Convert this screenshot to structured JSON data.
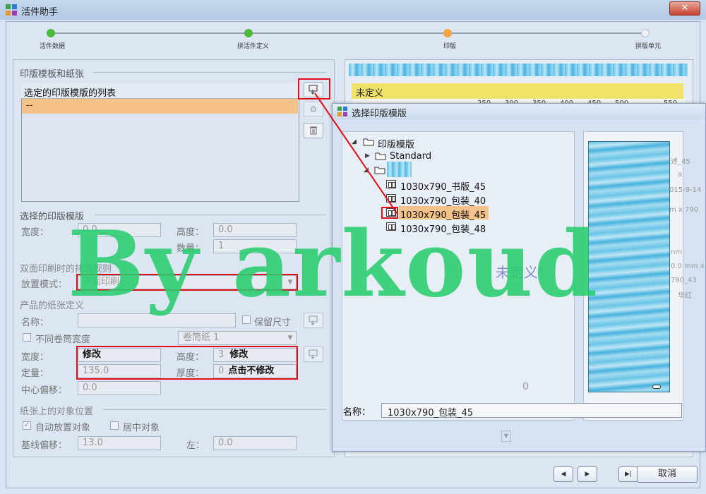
{
  "window": {
    "title": "活件助手",
    "close_label": "✕"
  },
  "steps": [
    {
      "label": "活件数据",
      "state": "done",
      "color": "#4cbb3c"
    },
    {
      "label": "拼活件定义",
      "state": "done",
      "color": "#4cbb3c"
    },
    {
      "label": "印版",
      "state": "current",
      "color": "#f7a340"
    },
    {
      "label": "拼版单元",
      "state": "todo",
      "color": "#e8ecf1"
    }
  ],
  "left": {
    "group_plates": "印版模板和纸张",
    "list_header": "选定的印版模版的列表",
    "list_rows": [
      "--"
    ],
    "group_selected": "选择的印版模版",
    "width_label": "宽度：",
    "width_value": "0.0",
    "height_label": "高度：",
    "height_value": "0.0",
    "qty_label": "数量：",
    "qty_value": "1",
    "duplex_title": "双面印刷时的排版规则",
    "placement_label": "放置模式：",
    "placement_value": "正面印刷",
    "paper_title": "产品的纸张定义",
    "name_label": "名称：",
    "name_value": "",
    "keep_size_label": "保留尺寸",
    "diff_roll_label": "不同卷筒宽度",
    "roll_select": "卷筒纸 1",
    "paper_width_label": "宽度：",
    "paper_width_value": "修改",
    "paper_height_label": "高度：",
    "paper_height_prefix": "3",
    "paper_height_value": "修改",
    "gsm_label": "定量：",
    "gsm_value": "135.0",
    "thickness_label": "厚度：",
    "thickness_prefix": "0",
    "thickness_value": "点击不修改",
    "offset_label": "中心偏移：",
    "offset_value": "0.0",
    "objpos_title": "纸张上的对象位置",
    "auto_place_label": "自动放置对象",
    "center_obj_label": "居中对象",
    "baseline_label": "基线偏移：",
    "baseline_value": "13.0",
    "left_label": "左：",
    "left_value": "0.0"
  },
  "right": {
    "undefined_label": "未定义",
    "ruler_ticks": [
      "250",
      "300",
      "350",
      "400",
      "450",
      "500",
      "550"
    ],
    "faded_side_texts": [
      "述_45",
      "a",
      "015-9-14",
      "m x 790",
      "nm",
      "0.0 mm x",
      "790_43",
      "华红"
    ],
    "faded_center_text": "未定义！",
    "zero_label": "0"
  },
  "dialog": {
    "title": "选择印版模版",
    "tree_root": "印版模版",
    "tree_standard": "Standard",
    "templates": [
      "1030x790_书版_45",
      "1030x790_包装_40",
      "1030x790_包装_45",
      "1030x790_包装_48"
    ],
    "selected_index": 2,
    "name_label": "名称：",
    "name_value": "1030x790_包装_45"
  },
  "watermark": "By arkoud",
  "buttons": {
    "prev": "◀",
    "next": "▶",
    "last": "▶|",
    "cancel": "取消"
  },
  "colors": {
    "selection": "#f5c28a",
    "highlight_red": "#e0101a",
    "watermark": "#28cd6e"
  }
}
